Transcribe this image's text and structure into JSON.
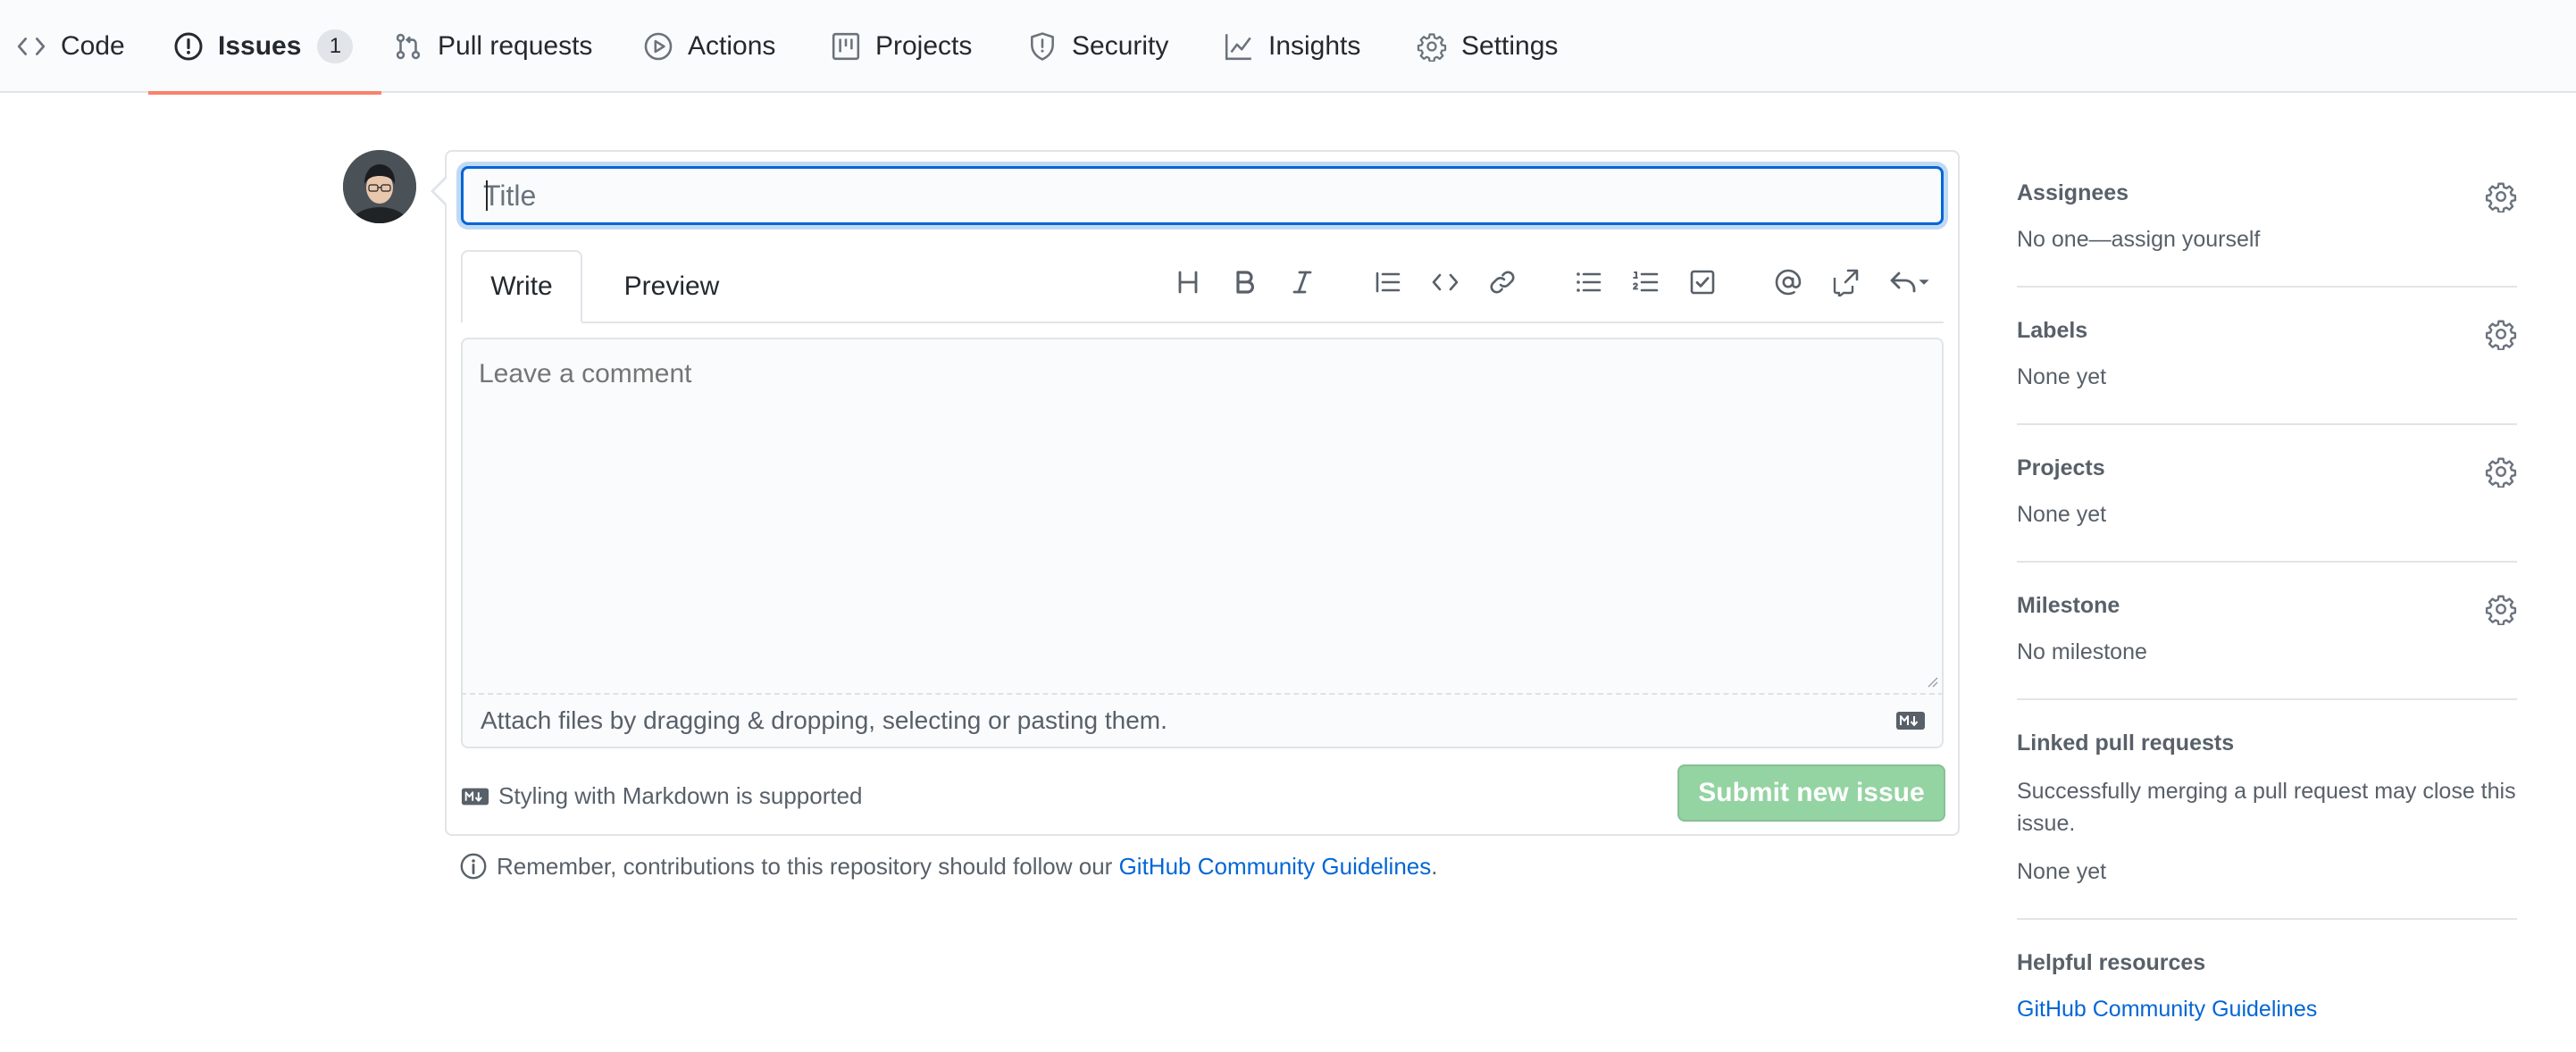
{
  "nav": {
    "tabs": [
      {
        "label": "Code",
        "icon": "code-icon"
      },
      {
        "label": "Issues",
        "icon": "issue-opened-icon",
        "count": "1",
        "selected": true
      },
      {
        "label": "Pull requests",
        "icon": "git-pull-request-icon"
      },
      {
        "label": "Actions",
        "icon": "play-icon"
      },
      {
        "label": "Projects",
        "icon": "project-icon"
      },
      {
        "label": "Security",
        "icon": "shield-icon"
      },
      {
        "label": "Insights",
        "icon": "graph-icon"
      },
      {
        "label": "Settings",
        "icon": "gear-icon"
      }
    ],
    "selected_underline_color": "#f9826c"
  },
  "form": {
    "title_placeholder": "Title",
    "tabs": {
      "write": "Write",
      "preview": "Preview"
    },
    "toolbar": [
      "heading-icon",
      "bold-icon",
      "italic-icon",
      "quote-icon",
      "code-icon",
      "link-icon",
      "unordered-list-icon",
      "ordered-list-icon",
      "task-list-icon",
      "mention-icon",
      "cross-reference-icon",
      "reply-icon"
    ],
    "comment_placeholder": "Leave a comment",
    "attach_text": "Attach files by dragging & dropping, selecting or pasting them.",
    "markdown_note": "Styling with Markdown is supported",
    "submit_label": "Submit new issue",
    "submit_color": "#94d3a2",
    "focus_color": "#0366d6"
  },
  "remember": {
    "prefix": "Remember, contributions to this repository should follow our ",
    "link": "GitHub Community Guidelines",
    "suffix": "."
  },
  "sidebar": {
    "assignees": {
      "heading": "Assignees",
      "value": "No one—assign yourself"
    },
    "labels": {
      "heading": "Labels",
      "value": "None yet"
    },
    "projects": {
      "heading": "Projects",
      "value": "None yet"
    },
    "milestone": {
      "heading": "Milestone",
      "value": "No milestone"
    },
    "linked_prs": {
      "heading": "Linked pull requests",
      "description": "Successfully merging a pull request may close this issue.",
      "value": "None yet"
    },
    "helpful": {
      "heading": "Helpful resources",
      "link": "GitHub Community Guidelines"
    }
  }
}
